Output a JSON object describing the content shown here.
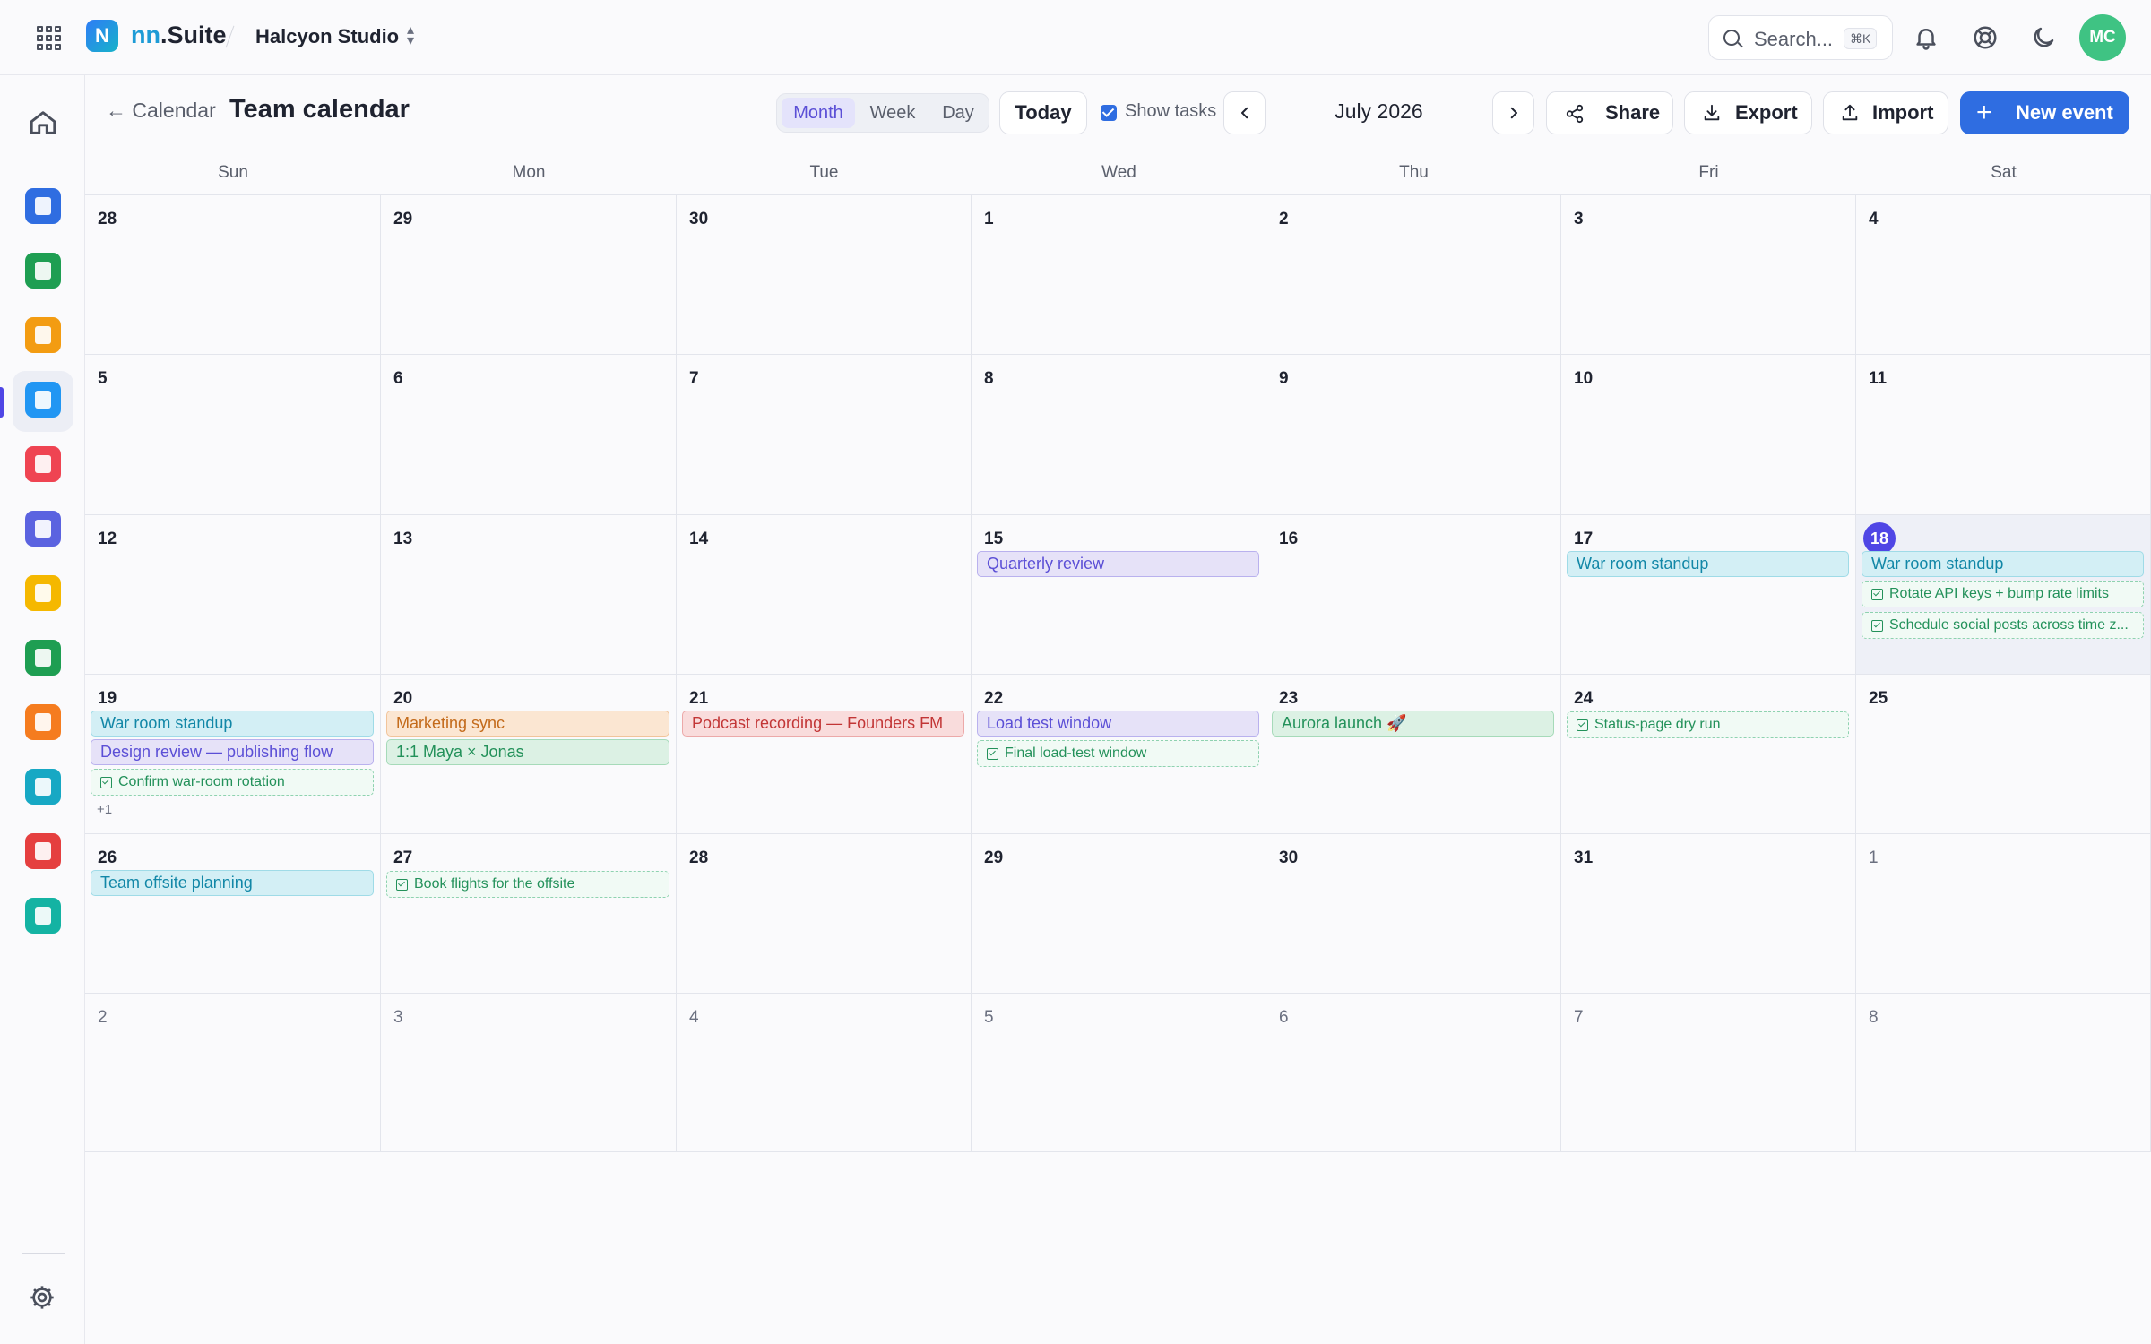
{
  "app": {
    "brand_prefix": "nn",
    "brand_suffix": ".Suite",
    "logo_letter": "N",
    "workspace": "Halcyon Studio"
  },
  "search": {
    "placeholder": "Search...",
    "shortcut": "⌘K"
  },
  "user": {
    "initials": "MC",
    "avatar_color": "#3fc383"
  },
  "topbar_icons": [
    "grid-icon",
    "bell-icon",
    "lifebuoy-icon",
    "moon-icon"
  ],
  "sidebar": {
    "home_icon": "home-icon",
    "apps": [
      {
        "name": "docs",
        "color": "#2f6de1"
      },
      {
        "name": "sheets",
        "color": "#1e9e52"
      },
      {
        "name": "slides",
        "color": "#f39c12"
      },
      {
        "name": "calendar",
        "color": "#2196f3",
        "active": true
      },
      {
        "name": "meet",
        "color": "#ef4452"
      },
      {
        "name": "forms",
        "color": "#5b63e0"
      },
      {
        "name": "notes",
        "color": "#f5b800"
      },
      {
        "name": "tasks",
        "color": "#1e9e52"
      },
      {
        "name": "contacts",
        "color": "#f57c1f"
      },
      {
        "name": "chat",
        "color": "#17a8c4"
      },
      {
        "name": "mail",
        "color": "#e53f3f"
      },
      {
        "name": "drive",
        "color": "#14b3a3"
      }
    ],
    "settings_icon": "gear-icon"
  },
  "header": {
    "back_label": "← Calendar",
    "title": "Team calendar",
    "views": [
      "Month",
      "Week",
      "Day"
    ],
    "active_view": "Month",
    "today_label": "Today",
    "show_tasks_label": "Show tasks",
    "show_tasks_checked": true,
    "month_label": "July 2026",
    "share_label": "Share",
    "export_label": "Export",
    "import_label": "Import",
    "new_event_label": "New event"
  },
  "calendar": {
    "weekdays": [
      "Sun",
      "Mon",
      "Tue",
      "Wed",
      "Thu",
      "Fri",
      "Sat"
    ],
    "weeks": [
      [
        {
          "day": "28",
          "other": false
        },
        {
          "day": "29",
          "other": false
        },
        {
          "day": "30",
          "other": false
        },
        {
          "day": "1"
        },
        {
          "day": "2"
        },
        {
          "day": "3"
        },
        {
          "day": "4"
        }
      ],
      [
        {
          "day": "5"
        },
        {
          "day": "6"
        },
        {
          "day": "7"
        },
        {
          "day": "8"
        },
        {
          "day": "9"
        },
        {
          "day": "10"
        },
        {
          "day": "11"
        }
      ],
      [
        {
          "day": "12"
        },
        {
          "day": "13"
        },
        {
          "day": "14"
        },
        {
          "day": "15",
          "items": [
            {
              "kind": "event",
              "color": "purple",
              "label": "Quarterly review"
            }
          ]
        },
        {
          "day": "16"
        },
        {
          "day": "17",
          "items": [
            {
              "kind": "event",
              "color": "blue",
              "label": "War room standup"
            }
          ]
        },
        {
          "day": "18",
          "today": true,
          "items": [
            {
              "kind": "event",
              "color": "blue",
              "label": "War room standup"
            },
            {
              "kind": "task",
              "label": "Rotate API keys + bump rate limits"
            },
            {
              "kind": "task",
              "label": "Schedule social posts across time z..."
            }
          ]
        }
      ],
      [
        {
          "day": "19",
          "items": [
            {
              "kind": "event",
              "color": "blue",
              "label": "War room standup"
            },
            {
              "kind": "event",
              "color": "purple",
              "label": "Design review — publishing flow"
            },
            {
              "kind": "task",
              "label": "Confirm war-room rotation"
            }
          ],
          "more": "+1"
        },
        {
          "day": "20",
          "items": [
            {
              "kind": "event",
              "color": "orange",
              "label": "Marketing sync"
            },
            {
              "kind": "event",
              "color": "green",
              "label": "1:1 Maya × Jonas"
            }
          ]
        },
        {
          "day": "21",
          "items": [
            {
              "kind": "event",
              "color": "red",
              "label": "Podcast recording — Founders FM"
            }
          ]
        },
        {
          "day": "22",
          "items": [
            {
              "kind": "event",
              "color": "purple",
              "label": "Load test window"
            },
            {
              "kind": "task",
              "label": "Final load-test window"
            }
          ]
        },
        {
          "day": "23",
          "items": [
            {
              "kind": "event",
              "color": "green",
              "label": "Aurora launch 🚀"
            }
          ]
        },
        {
          "day": "24",
          "items": [
            {
              "kind": "task",
              "label": "Status-page dry run"
            }
          ]
        },
        {
          "day": "25"
        }
      ],
      [
        {
          "day": "26",
          "items": [
            {
              "kind": "event",
              "color": "blue",
              "label": "Team offsite planning"
            }
          ]
        },
        {
          "day": "27",
          "items": [
            {
              "kind": "task",
              "label": "Book flights for the offsite"
            }
          ]
        },
        {
          "day": "28"
        },
        {
          "day": "29"
        },
        {
          "day": "30"
        },
        {
          "day": "31"
        },
        {
          "day": "1",
          "other": true
        }
      ],
      [
        {
          "day": "2",
          "other": true
        },
        {
          "day": "3",
          "other": true
        },
        {
          "day": "4",
          "other": true
        },
        {
          "day": "5",
          "other": true
        },
        {
          "day": "6",
          "other": true
        },
        {
          "day": "7",
          "other": true
        },
        {
          "day": "8",
          "other": true
        }
      ]
    ]
  }
}
